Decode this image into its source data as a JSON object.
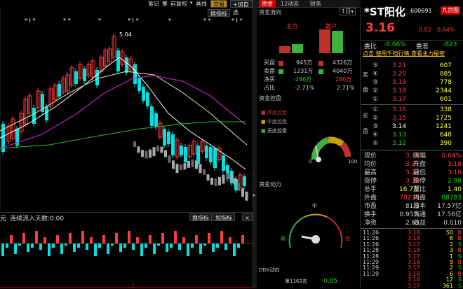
{
  "toolbar": {
    "items": [
      "笔记",
      "筹",
      "前复权",
      "画线",
      "交易"
    ],
    "add_label": "加自选",
    "indicator_label": "换指标",
    "day_label": "1日"
  },
  "chart": {
    "high_label": "5.04",
    "markers": [
      "* I *",
      "* *",
      "*",
      "* I *",
      "*",
      "* *",
      "* I *"
    ],
    "indicator_caption": "连续流入天数:0.00",
    "indicator_prefix": "元",
    "btn_change": "换指标",
    "btn_add": "加指标"
  },
  "mid": {
    "tabs": [
      "资金",
      "12动态",
      "财务"
    ],
    "flow_title": "资金流向",
    "col_main": "主力",
    "col_retail": "散户",
    "rows": [
      {
        "label": "买盘",
        "main": "945万",
        "retail": "4326万"
      },
      {
        "label": "卖盘",
        "main": "1231万",
        "retail": "4040万"
      },
      {
        "label": "净买",
        "main": "-286万",
        "retail": "286万"
      },
      {
        "label": "占比",
        "main": "-2.71%",
        "retail": "2.71%"
      }
    ],
    "control_title": "资金控盘",
    "legend": [
      "高度控盘",
      "中度控盘",
      "无庄控盘"
    ],
    "gauge1_min": "0",
    "gauge1_max": "100",
    "power_title": "资金动力",
    "g2_top": "中",
    "g2_left": "弱",
    "g2_right": "强",
    "rank_title": "DDX动向",
    "rank_label": "第1162名",
    "rank_value": "-0.05"
  },
  "quote": {
    "name": "*ST阳化",
    "code": "600691",
    "badge": "九宫图",
    "price": "3.16",
    "change": "0.02",
    "pct": "0.64%",
    "weibi_label": "委比",
    "weibi": "-8.66%",
    "weicha_label": "委差",
    "weicha": "-823",
    "promo": "点击 使用千档行情,查看主力秘密",
    "sells": [
      {
        "n": "⑤",
        "p": "3.21",
        "v": "607"
      },
      {
        "n": "④",
        "p": "3.20",
        "v": "885"
      },
      {
        "n": "③",
        "p": "3.19",
        "v": "778"
      },
      {
        "n": "②",
        "p": "3.18",
        "v": "2344"
      },
      {
        "n": "①",
        "p": "3.17",
        "v": "601"
      }
    ],
    "buys": [
      {
        "n": "①",
        "p": "3.16",
        "v": "338"
      },
      {
        "n": "②",
        "p": "3.15",
        "v": "1725"
      },
      {
        "n": "③",
        "p": "3.14",
        "v": "1241"
      },
      {
        "n": "④",
        "p": "3.13",
        "v": "648"
      },
      {
        "n": "⑤",
        "p": "3.12",
        "v": "390"
      }
    ],
    "sell_side": "卖盘",
    "buy_side": "买盘",
    "stats": [
      [
        "现价",
        "3.16",
        "涨幅",
        "0.64%"
      ],
      [
        "均价",
        "3.21",
        "开盘",
        "3.18"
      ],
      [
        "最高",
        "3.27",
        "最低",
        "3.16"
      ],
      [
        "涨停",
        "3.30",
        "跌停",
        "2.98"
      ],
      [
        "总手",
        "16.7万",
        "量比",
        "1.40"
      ],
      [
        "外盘",
        "78234",
        "内盘",
        "88783"
      ],
      [
        "市盈",
        "81.3",
        "股本",
        "17.57亿"
      ],
      [
        "换手",
        "0.95%",
        "流通",
        "17.56亿"
      ],
      [
        "净资",
        "2.63",
        "收益",
        "0.010"
      ]
    ],
    "ticks": [
      [
        "11:26",
        "3.18",
        "50",
        "B"
      ],
      [
        "11:26",
        "3.18",
        "6",
        "B"
      ],
      [
        "11:26",
        "3.17",
        "2",
        "S"
      ],
      [
        "11:28",
        "3.18",
        "3",
        "B"
      ],
      [
        "11:28",
        "3.17",
        "1",
        "S"
      ],
      [
        "11:29",
        "3.18",
        "9",
        "B"
      ],
      [
        "11:29",
        "3.17",
        "2",
        "S"
      ],
      [
        "11:29",
        "3.18",
        "6",
        "B"
      ],
      [
        "",
        "3.16",
        "12",
        "S"
      ],
      [
        "",
        "3.17",
        "361",
        "S"
      ]
    ]
  }
}
